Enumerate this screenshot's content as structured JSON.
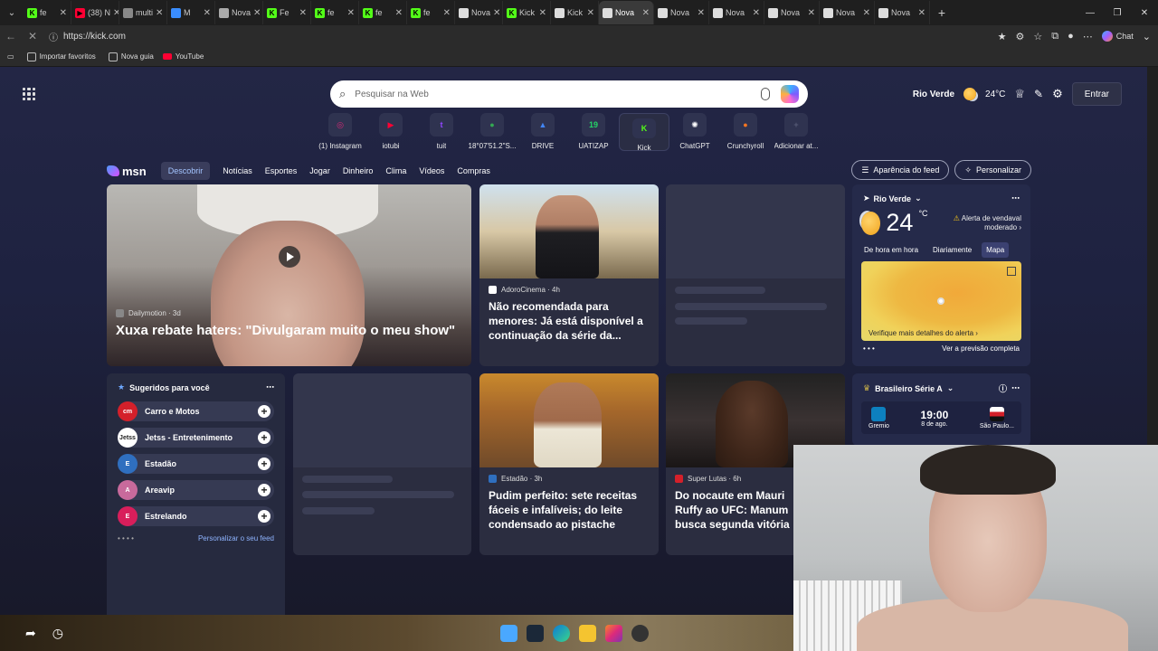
{
  "tabs": [
    {
      "label": "fe",
      "color": "#53fc18",
      "glyph": "K"
    },
    {
      "label": "(38) N",
      "color": "#ff0033",
      "glyph": "▶"
    },
    {
      "label": "multi",
      "color": "#888888",
      "glyph": ""
    },
    {
      "label": "M",
      "color": "#3a8dff",
      "glyph": ""
    },
    {
      "label": "Nova",
      "color": "#aaaaaa",
      "glyph": ""
    },
    {
      "label": "Fe",
      "color": "#53fc18",
      "glyph": "K"
    },
    {
      "label": "fe",
      "color": "#53fc18",
      "glyph": "K"
    },
    {
      "label": "fe",
      "color": "#53fc18",
      "glyph": "K"
    },
    {
      "label": "fe",
      "color": "#53fc18",
      "glyph": "K"
    },
    {
      "label": "Nova",
      "color": "#dddddd",
      "glyph": ""
    },
    {
      "label": "Kick",
      "color": "#53fc18",
      "glyph": "K"
    },
    {
      "label": "Kick",
      "color": "#dddddd",
      "glyph": ""
    },
    {
      "label": "Nova",
      "color": "#dddddd",
      "glyph": "",
      "active": true
    },
    {
      "label": "Nova",
      "color": "#dddddd",
      "glyph": ""
    },
    {
      "label": "Nova",
      "color": "#dddddd",
      "glyph": ""
    },
    {
      "label": "Nova",
      "color": "#dddddd",
      "glyph": ""
    },
    {
      "label": "Nova",
      "color": "#dddddd",
      "glyph": ""
    },
    {
      "label": "Nova",
      "color": "#dddddd",
      "glyph": ""
    }
  ],
  "address": {
    "url": "https://kick.com",
    "copilot_label": "Chat"
  },
  "favorites": [
    "Importar favoritos",
    "Nova guia",
    "YouTube"
  ],
  "search": {
    "placeholder": "Pesquisar na Web"
  },
  "topright": {
    "city": "Rio Verde",
    "temp": "24°C",
    "signin": "Entrar"
  },
  "shortcuts": [
    {
      "label": "(1) Instagram",
      "color": "#d62976",
      "glyph": "◎"
    },
    {
      "label": "iotubi",
      "color": "#ff0033",
      "glyph": "▶"
    },
    {
      "label": "tuit",
      "color": "#9146ff",
      "glyph": "t"
    },
    {
      "label": "18°07'51.2\"S...",
      "color": "#34a853",
      "glyph": "●"
    },
    {
      "label": "DRIVE",
      "color": "#4285f4",
      "glyph": "▲"
    },
    {
      "label": "UATIZAP",
      "color": "#25d366",
      "glyph": "19"
    },
    {
      "label": "Kick",
      "color": "#53fc18",
      "glyph": "K",
      "selected": true
    },
    {
      "label": "ChatGPT",
      "color": "#ffffff",
      "glyph": "✺"
    },
    {
      "label": "Crunchyroll",
      "color": "#f47521",
      "glyph": "●"
    },
    {
      "label": "Adicionar at...",
      "color": "#555a75",
      "glyph": "+"
    }
  ],
  "msn": {
    "logo": "msn",
    "nav": [
      "Descobrir",
      "Notícias",
      "Esportes",
      "Jogar",
      "Dinheiro",
      "Clima",
      "Vídeos",
      "Compras"
    ],
    "feed_button": "Aparência do feed",
    "personalize_button": "Personalizar"
  },
  "hero": {
    "source": "Dailymotion · 3d",
    "headline": "Xuxa rebate haters: \"Divulgaram muito o meu show\""
  },
  "card2": {
    "source": "AdoroCinema · 4h",
    "headline": "Não recomendada para menores: Já está disponível a continuação da série da..."
  },
  "weather": {
    "city": "Rio Verde",
    "temp": "24",
    "unit": "°C",
    "alert": "Alerta de vendaval moderado",
    "tabs": [
      "De hora em hora",
      "Diariamente",
      "Mapa"
    ],
    "map_link": "Verifique mais detalhes do alerta",
    "forecast_link": "Ver a previsão completa"
  },
  "suggested": {
    "title": "Sugeridos para você",
    "items": [
      {
        "name": "Carro e Motos",
        "color": "#d4202a",
        "abbr": "cm"
      },
      {
        "name": "Jetss - Entretenimento",
        "color": "#ffffff",
        "abbr": "Jetss"
      },
      {
        "name": "Estadão",
        "color": "#2f6fbf",
        "abbr": "E"
      },
      {
        "name": "Areavip",
        "color": "#c86a9c",
        "abbr": "A"
      },
      {
        "name": "Estrelando",
        "color": "#d81e5b",
        "abbr": "E"
      }
    ],
    "footer_link": "Personalizar o seu feed"
  },
  "card6": {
    "source": "Estadão · 3h",
    "headline": "Pudim perfeito: sete receitas fáceis e infalíveis; do leite condensado ao pistache"
  },
  "card7": {
    "source": "Super Lutas · 6h",
    "headline1": "Do nocaute em Mauri",
    "headline2": "Ruffy ao UFC: Manum",
    "headline3": "busca segunda vitória"
  },
  "sport": {
    "league": "Brasileiro Série A",
    "home": "Gremio",
    "away": "São Paulo...",
    "time": "19:00",
    "date": "8 de ago."
  }
}
